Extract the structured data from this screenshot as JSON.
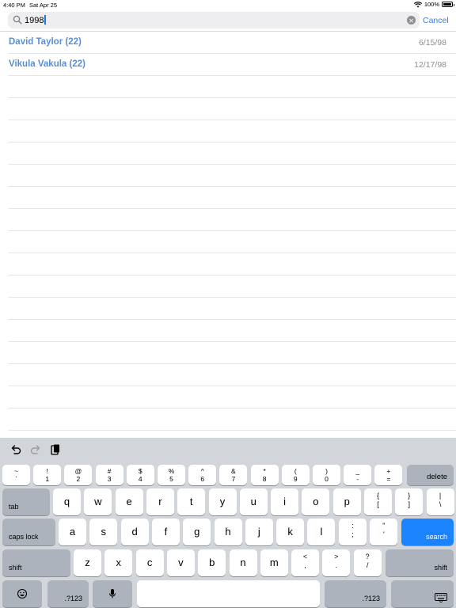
{
  "status_bar": {
    "time": "4:40 PM",
    "date": "Sat Apr 25",
    "battery": "100%"
  },
  "search": {
    "query": "1998",
    "cancel_label": "Cancel"
  },
  "results": [
    {
      "name": "David Taylor (22)",
      "date": "6/15/98"
    },
    {
      "name": "Vikula Vakula (22)",
      "date": "12/17/98"
    }
  ],
  "keyboard": {
    "row1": [
      {
        "top": "~",
        "bot": "`"
      },
      {
        "top": "!",
        "bot": "1"
      },
      {
        "top": "@",
        "bot": "2"
      },
      {
        "top": "#",
        "bot": "3"
      },
      {
        "top": "$",
        "bot": "4"
      },
      {
        "top": "%",
        "bot": "5"
      },
      {
        "top": "^",
        "bot": "6"
      },
      {
        "top": "&",
        "bot": "7"
      },
      {
        "top": "*",
        "bot": "8"
      },
      {
        "top": "(",
        "bot": "9"
      },
      {
        "top": ")",
        "bot": "0"
      },
      {
        "top": "_",
        "bot": "-"
      },
      {
        "top": "+",
        "bot": "="
      }
    ],
    "delete_label": "delete",
    "tab_label": "tab",
    "row2": [
      "q",
      "w",
      "e",
      "r",
      "t",
      "y",
      "u",
      "i",
      "o",
      "p"
    ],
    "row2_sym": [
      {
        "top": "{",
        "bot": "["
      },
      {
        "top": "}",
        "bot": "]"
      },
      {
        "top": "|",
        "bot": "\\"
      }
    ],
    "caps_label": "caps lock",
    "row3": [
      "a",
      "s",
      "d",
      "f",
      "g",
      "h",
      "j",
      "k",
      "l"
    ],
    "row3_sym": [
      {
        "top": ":",
        "bot": ";"
      },
      {
        "top": "\"",
        "bot": "'"
      }
    ],
    "search_label": "search",
    "shift_label": "shift",
    "row4": [
      "z",
      "x",
      "c",
      "v",
      "b",
      "n",
      "m"
    ],
    "row4_sym": [
      {
        "top": "<",
        "bot": ","
      },
      {
        "top": ">",
        "bot": "."
      },
      {
        "top": "?",
        "bot": "/"
      }
    ],
    "num_label": ".?123"
  },
  "colors": {
    "accent": "#3b7fe0",
    "name_link": "#5b8dd6",
    "search_key": "#1a84ff",
    "keyboard_bg": "#d2d5da"
  }
}
